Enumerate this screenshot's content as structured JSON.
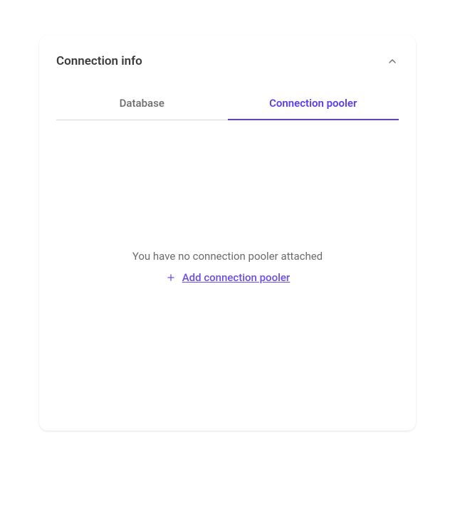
{
  "card": {
    "title": "Connection info"
  },
  "tabs": {
    "database": "Database",
    "pooler": "Connection pooler"
  },
  "empty": {
    "message": "You have no connection pooler attached",
    "action": "Add connection pooler"
  }
}
